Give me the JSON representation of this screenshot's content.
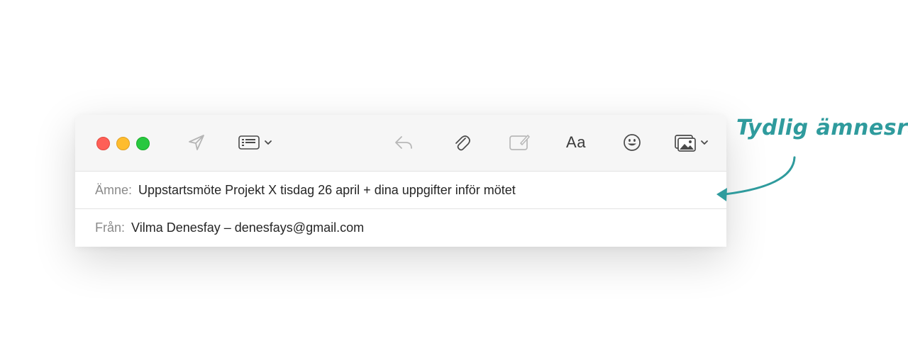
{
  "window": {
    "controls": [
      "close",
      "minimize",
      "maximize"
    ]
  },
  "toolbar": {
    "icons": [
      "send-icon",
      "header-fields-icon",
      "reply-icon",
      "attachment-icon",
      "markup-icon",
      "fonts",
      "emoji-icon",
      "photo-browser-icon"
    ],
    "fonts_label": "Aa"
  },
  "fields": {
    "subject": {
      "label": "Ämne:",
      "value": "Uppstartsmöte Projekt X tisdag 26 april + dina uppgifter inför mötet"
    },
    "from": {
      "label": "Från:",
      "value": "Vilma Denesfay – denesfays@gmail.com"
    }
  },
  "annotation": {
    "text": "Tydlig ämnesrad",
    "color": "#2f9b9d"
  },
  "colors": {
    "close": "#fe5f57",
    "minimize": "#febc2e",
    "maximize": "#28c840",
    "toolbar_bg": "#f6f6f6"
  }
}
